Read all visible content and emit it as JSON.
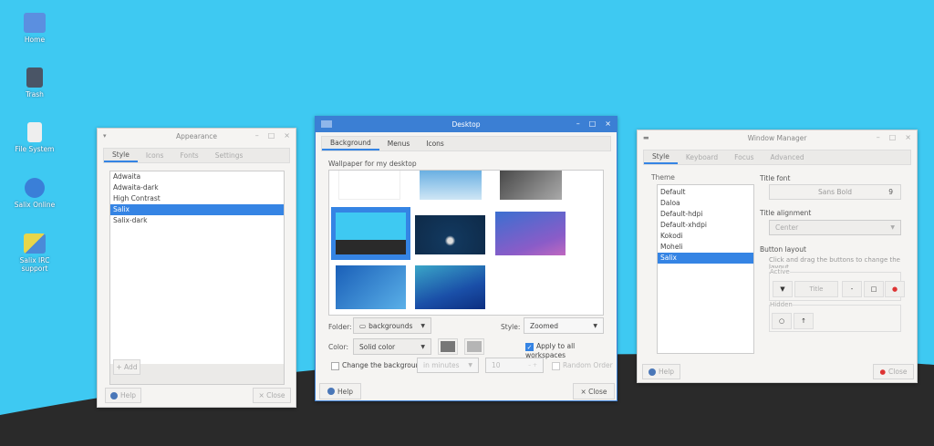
{
  "desktop_icons": [
    {
      "label": "Home",
      "icon": "folder-home-icon"
    },
    {
      "label": "Trash",
      "icon": "trash-icon"
    },
    {
      "label": "File System",
      "icon": "drive-icon"
    },
    {
      "label": "Salix Online",
      "icon": "globe-icon"
    },
    {
      "label": "Salix IRC support",
      "icon": "chat-icon"
    }
  ],
  "appearance": {
    "title": "Appearance",
    "tabs": [
      "Style",
      "Icons",
      "Fonts",
      "Settings"
    ],
    "themes": [
      "Adwaita",
      "Adwaita-dark",
      "High Contrast",
      "Salix",
      "Salix-dark"
    ],
    "selected": "Salix",
    "add": "+ Add",
    "help": "Help",
    "close": "× Close"
  },
  "desktop": {
    "title": "Desktop",
    "tabs": [
      "Background",
      "Menus",
      "Icons"
    ],
    "wallpaper_label": "Wallpaper for my desktop",
    "folder_label": "Folder:",
    "folder_value": "backgrounds",
    "style_label": "Style:",
    "style_value": "Zoomed",
    "color_label": "Color:",
    "color_value": "Solid color",
    "apply_all": "Apply to all workspaces",
    "change_bg": "Change the background",
    "interval_unit": "in minutes",
    "interval_value": "10",
    "random": "Random Order",
    "help": "Help",
    "close": "× Close",
    "colors": {
      "primary": "#777777",
      "secondary": "#b5b5b5"
    }
  },
  "wm": {
    "title": "Window Manager",
    "tabs": [
      "Style",
      "Keyboard",
      "Focus",
      "Advanced"
    ],
    "theme_label": "Theme",
    "themes": [
      "Default",
      "Daloa",
      "Default-hdpi",
      "Default-xhdpi",
      "Kokodi",
      "Moheli",
      "Salix"
    ],
    "selected": "Salix",
    "title_font_label": "Title font",
    "font_name": "Sans Bold",
    "font_size": "9",
    "title_align_label": "Title alignment",
    "align_value": "Center",
    "button_layout_label": "Button layout",
    "button_hint": "Click and drag the buttons to change the layout",
    "active_label": "Active",
    "title_btn": "Title",
    "hidden_label": "Hidden",
    "help": "Help",
    "close": "Close"
  }
}
